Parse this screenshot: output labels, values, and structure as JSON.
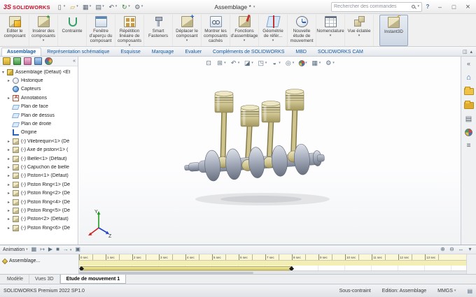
{
  "titlebar": {
    "logo_glyph": "3S",
    "logo_text": "SOLIDWORKS",
    "quick_access": [
      {
        "icon": "new-doc",
        "name": "new-document-button"
      },
      {
        "icon": "open-doc",
        "name": "open-document-button"
      },
      {
        "icon": "save-doc",
        "name": "save-button"
      },
      {
        "icon": "print-doc",
        "name": "print-button"
      },
      {
        "icon": "undo",
        "name": "undo-button"
      },
      {
        "icon": "rebuild",
        "name": "rebuild-button"
      },
      {
        "icon": "options-gear",
        "name": "options-button"
      }
    ],
    "doc_title": "Assemblage *",
    "search_placeholder": "Rechercher des commandes",
    "help_label": "?"
  },
  "ribbon": {
    "buttons": [
      {
        "label": "Editer le composant",
        "icon": "edit-component"
      },
      {
        "label": "Insérer des composants",
        "icon": "insert-components",
        "caret": true
      },
      {
        "label": "Contrainte",
        "icon": "mate"
      },
      {
        "label": "Fenêtre d'aperçu du composant",
        "icon": "preview-window"
      },
      {
        "label": "Répétition linéaire de composants",
        "icon": "linear-pattern",
        "caret": true
      },
      {
        "label": "Smart Fasteners",
        "icon": "smart-fasteners"
      },
      {
        "label": "Déplacer le composant",
        "icon": "move-component",
        "caret": true
      },
      {
        "label": "Montrer les composants cachés",
        "icon": "show-hidden"
      },
      {
        "label": "Fonctions d'assemblage",
        "icon": "assembly-features",
        "caret": true
      },
      {
        "label": "Géométrie de référ...",
        "icon": "reference-geometry",
        "caret": true
      },
      {
        "label": "Nouvelle étude de mouvement",
        "icon": "motion-study"
      },
      {
        "label": "Nomenclature",
        "icon": "bom",
        "caret": true
      },
      {
        "label": "Vue éclatée",
        "icon": "exploded-view",
        "caret": true
      },
      {
        "label": "Instant3D",
        "icon": "instant3d",
        "active": true,
        "sep": true
      }
    ]
  },
  "tabstrip": {
    "tabs": [
      {
        "label": "Assemblage",
        "active": true
      },
      {
        "label": "Représentation schématique"
      },
      {
        "label": "Esquisse"
      },
      {
        "label": "Marquage"
      },
      {
        "label": "Evaluer"
      },
      {
        "label": "Compléments de SOLIDWORKS"
      },
      {
        "label": "MBD"
      },
      {
        "label": "SOLIDWORKS CAM"
      }
    ]
  },
  "featuretree": {
    "panel_tabs": [
      {
        "icon": "featuremanager-tab",
        "name": "featuremanager-tab"
      },
      {
        "icon": "propertymanager-tab",
        "name": "propertymanager-tab"
      },
      {
        "icon": "configuration-tab",
        "name": "configurationmanager-tab"
      },
      {
        "icon": "dimxpert-tab",
        "name": "dimxpertmanager-tab"
      },
      {
        "icon": "displaymanager-tab",
        "name": "displaymanager-tab"
      }
    ],
    "items": [
      {
        "label": "Assemblage (Défaut) <Et",
        "icon": "assembly",
        "arrow": true,
        "open": true,
        "indent": 0
      },
      {
        "label": "Historique",
        "icon": "history",
        "arrow": true,
        "indent": 1
      },
      {
        "label": "Capteurs",
        "icon": "sensors",
        "indent": 1
      },
      {
        "label": "Annotations",
        "icon": "annotations",
        "arrow": true,
        "indent": 1
      },
      {
        "label": "Plan de face",
        "icon": "plane",
        "indent": 1
      },
      {
        "label": "Plan de dessus",
        "icon": "plane",
        "indent": 1
      },
      {
        "label": "Plan de droite",
        "icon": "plane",
        "indent": 1
      },
      {
        "label": "Origine",
        "icon": "origin",
        "indent": 1
      },
      {
        "label": "(-) Vilebrequin<1> (Dé",
        "icon": "part",
        "arrow": true,
        "indent": 1
      },
      {
        "label": "(-) Axe de piston<1> (",
        "icon": "part",
        "arrow": true,
        "indent": 1
      },
      {
        "label": "(-) Bielle<1> (Défaut)",
        "icon": "part",
        "arrow": true,
        "indent": 1
      },
      {
        "label": "(-) Capuchon de bielle",
        "icon": "part",
        "arrow": true,
        "indent": 1
      },
      {
        "label": "(-) Piston<1> (Défaut)",
        "icon": "part",
        "arrow": true,
        "indent": 1
      },
      {
        "label": "(-) Piston Ring<1> (Dé",
        "icon": "part",
        "arrow": true,
        "indent": 1
      },
      {
        "label": "(-) Piston Ring<2> (Dé",
        "icon": "part",
        "arrow": true,
        "indent": 1
      },
      {
        "label": "(-) Piston Ring<4> (Dé",
        "icon": "part",
        "arrow": true,
        "indent": 1
      },
      {
        "label": "(-) Piston Ring<5> (Dé",
        "icon": "part",
        "arrow": true,
        "indent": 1
      },
      {
        "label": "(-) Piston<2> (Défaut)",
        "icon": "part",
        "arrow": true,
        "indent": 1
      },
      {
        "label": "(-) Piston Ring<6> (Dé",
        "icon": "part",
        "arrow": true,
        "indent": 1
      }
    ]
  },
  "viewport": {
    "hud": [
      {
        "icon": "zoom-fit",
        "name": "zoom-to-fit-icon"
      },
      {
        "icon": "zoom-area",
        "name": "zoom-to-area-icon",
        "caret": true
      },
      {
        "icon": "prev-view",
        "name": "previous-view-icon",
        "caret": true
      },
      {
        "icon": "section-view",
        "name": "section-view-icon",
        "caret": true
      },
      {
        "icon": "orientation-cube",
        "name": "view-orientation-icon",
        "caret": true
      },
      {
        "icon": "display-style",
        "name": "display-style-icon",
        "caret": true
      },
      {
        "icon": "hide-show",
        "name": "hide-show-items-icon",
        "caret": true
      },
      {
        "icon": "edit-appearance",
        "name": "edit-appearance-icon",
        "caret": true
      },
      {
        "icon": "scene",
        "name": "apply-scene-icon",
        "caret": true
      },
      {
        "icon": "view-settings",
        "name": "view-settings-icon",
        "caret": true
      }
    ],
    "triad": {
      "y": "Y",
      "z": "Z"
    }
  },
  "taskpane": {
    "icons": [
      {
        "icon": "collapse-pane",
        "name": "collapse-pane-icon"
      },
      {
        "icon": "home",
        "name": "home-icon"
      },
      {
        "icon": "design-library",
        "name": "design-library-icon"
      },
      {
        "icon": "file-explorer",
        "name": "file-explorer-icon"
      },
      {
        "icon": "view-palette",
        "name": "view-palette-icon"
      },
      {
        "icon": "appearances",
        "name": "appearances-scenes-icon"
      },
      {
        "icon": "custom-properties",
        "name": "custom-properties-icon"
      }
    ]
  },
  "timeline": {
    "study_label": "Animation",
    "controls": [
      {
        "icon": "calculator",
        "name": "calculate-icon"
      },
      {
        "icon": "play-from-start",
        "name": "play-from-start-icon"
      },
      {
        "icon": "play",
        "name": "play-icon"
      },
      {
        "icon": "stop",
        "name": "stop-icon"
      },
      {
        "icon": "playback-mode",
        "name": "playback-mode-icon",
        "caret": true
      },
      {
        "icon": "save-animation",
        "name": "save-animation-icon"
      }
    ],
    "right_controls": [
      {
        "icon": "timeline-zoom-in",
        "name": "timeline-zoom-in-icon"
      },
      {
        "icon": "timeline-zoom-out",
        "name": "timeline-zoom-out-icon"
      },
      {
        "icon": "timeline-fit",
        "name": "timeline-fit-icon"
      },
      {
        "icon": "collapse-motionmanager",
        "name": "collapse-motionmanager-icon"
      }
    ],
    "ticks": [
      "0 sec",
      "1 sec",
      "2 sec",
      "3 sec",
      "4 sec",
      "5 sec",
      "6 sec",
      "7 sec",
      "8 sec",
      "9 sec",
      "10 sec",
      "11 sec",
      "12 sec",
      "13 sec"
    ],
    "rows": [
      {
        "label": "Assemblage...",
        "name": "motion-tree-assemblage"
      }
    ]
  },
  "doctabs": {
    "tabs": [
      {
        "label": "Modèle"
      },
      {
        "label": "Vues 3D"
      },
      {
        "label": "Etude de mouvement 1",
        "active": true
      }
    ]
  },
  "statusbar": {
    "product": "SOLIDWORKS Premium 2022 SP1.0",
    "constraint_state": "Sous-contraint",
    "edit_mode": "Edition: Assemblage",
    "units": "MMGS"
  },
  "colors": {
    "brand_red": "#c8102e",
    "timeline_bar": "#d9cf6e",
    "active_tool_highlight": "#ccd6e3"
  }
}
